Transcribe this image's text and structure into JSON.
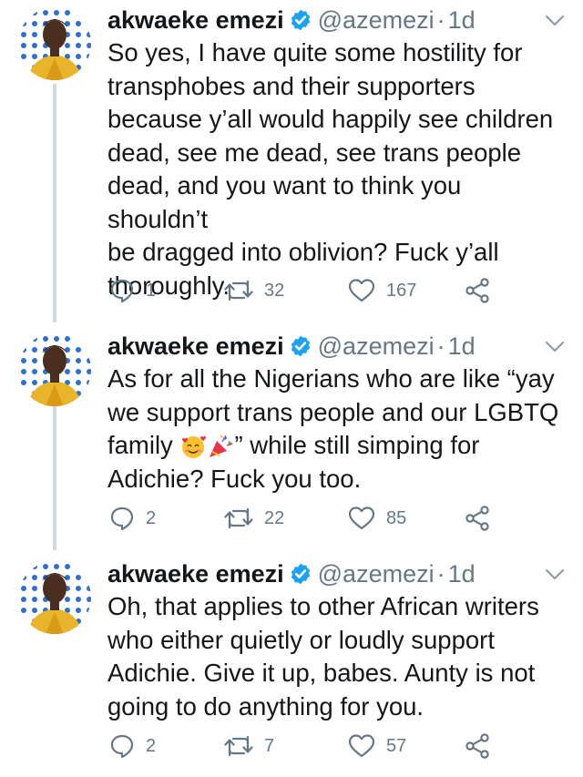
{
  "tweets": [
    {
      "name": "akwaeke emezi",
      "handle": "@azemezi",
      "time": "1d",
      "lines": [
        "So yes, I have quite some hostility for",
        "transphobes and their supporters",
        "because y’all would happily see children",
        "dead, see me dead, see trans people",
        "dead, and you want to think you shouldn’t",
        "be dragged into oblivion? Fuck y’all",
        "thoroughly."
      ],
      "replies": "1",
      "retweets": "32",
      "likes": "167"
    },
    {
      "name": "akwaeke emezi",
      "handle": "@azemezi",
      "time": "1d",
      "lines": [
        "As for all the Nigerians who are like “yay",
        "we support trans people and our LGBTQ",
        "family",
        "” while still simping for",
        "Adichie? Fuck you too."
      ],
      "emoji": [
        "smiling-face-with-hearts",
        "party-popper"
      ],
      "replies": "2",
      "retweets": "22",
      "likes": "85"
    },
    {
      "name": "akwaeke emezi",
      "handle": "@azemezi",
      "time": "1d",
      "lines": [
        "Oh, that applies to other African writers",
        "who either quietly or loudly support",
        "Adichie. Give it up, babes. Aunty is not",
        "going to do anything for you."
      ],
      "replies": "2",
      "retweets": "7",
      "likes": "57"
    }
  ],
  "icons": {
    "verified": "verified-badge-icon",
    "caret": "chevron-down-icon",
    "reply": "reply-icon",
    "retweet": "retweet-icon",
    "like": "heart-icon",
    "share": "share-icon"
  },
  "colors": {
    "text": "#14171a",
    "secondary": "#657786",
    "verified": "#1da1f2",
    "thread_line": "#cfd9de"
  }
}
